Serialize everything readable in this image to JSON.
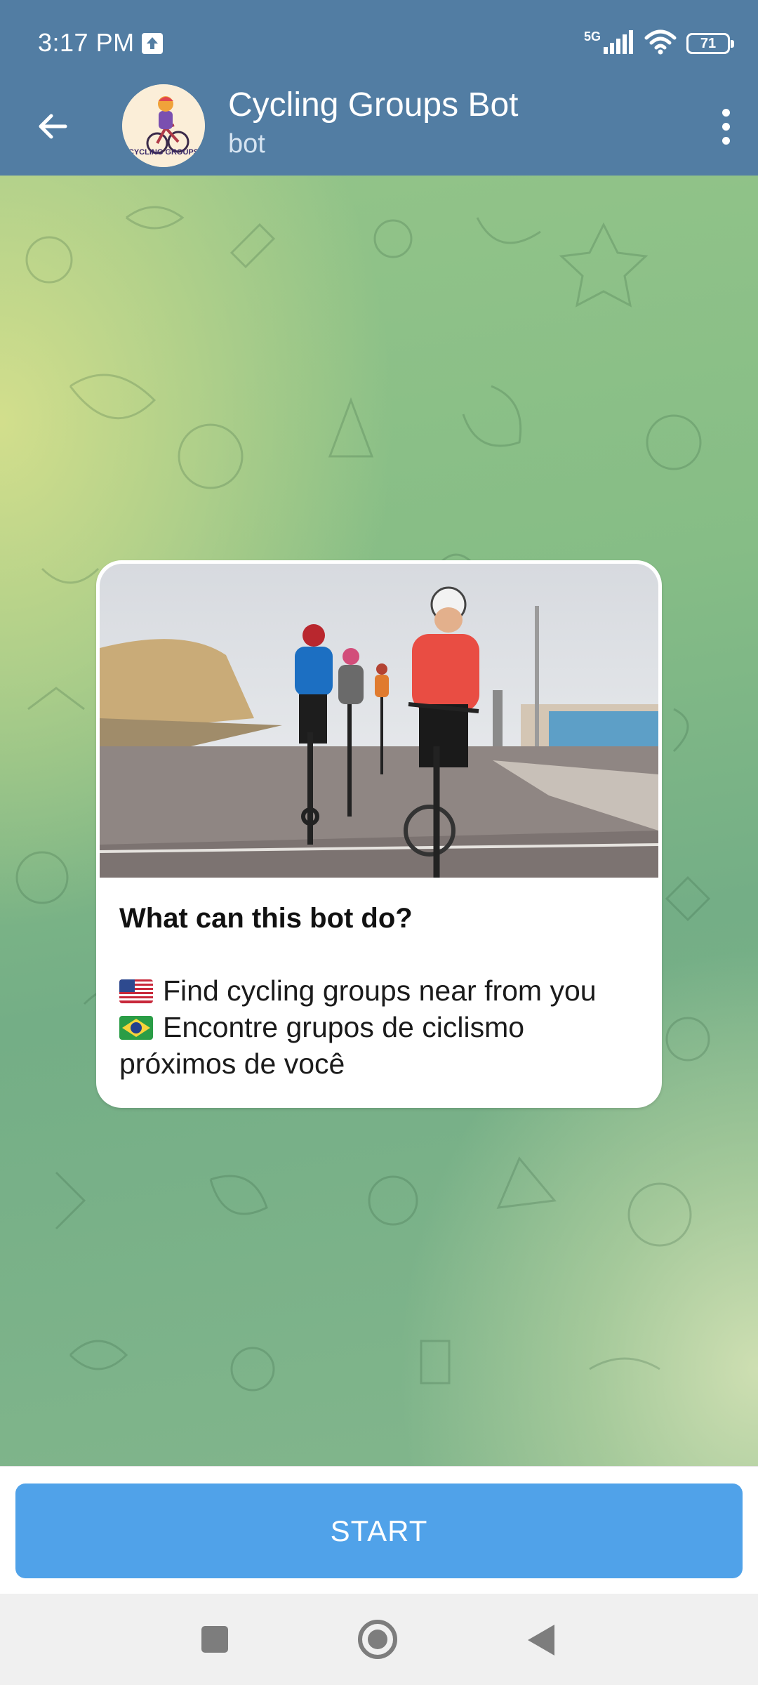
{
  "status_bar": {
    "time": "3:17 PM",
    "network": "5G",
    "battery": "71",
    "icons": [
      "upload-icon",
      "signal-icon",
      "wifi-icon",
      "battery-icon"
    ]
  },
  "header": {
    "title": "Cycling Groups Bot",
    "subtitle": "bot",
    "back_icon": "arrow-left-icon",
    "menu_icon": "vertical-dots-icon",
    "avatar_logo_text": "CYCLING GROUPS"
  },
  "message": {
    "heading": "What can this bot do?",
    "lines": [
      {
        "flag": "us-flag-icon",
        "text": "Find cycling groups near from you"
      },
      {
        "flag": "brazil-flag-icon",
        "text": "Encontre grupos de ciclismo"
      },
      {
        "flag": "",
        "text": "próximos de você"
      }
    ]
  },
  "bottom": {
    "start_label": "START"
  },
  "nav_bar": {
    "icons": [
      "recents-square-icon",
      "home-circle-icon",
      "back-triangle-icon"
    ]
  },
  "colors": {
    "header_bg": "#527da3",
    "start_button": "#50a2e9",
    "card_bg": "#ffffff"
  }
}
